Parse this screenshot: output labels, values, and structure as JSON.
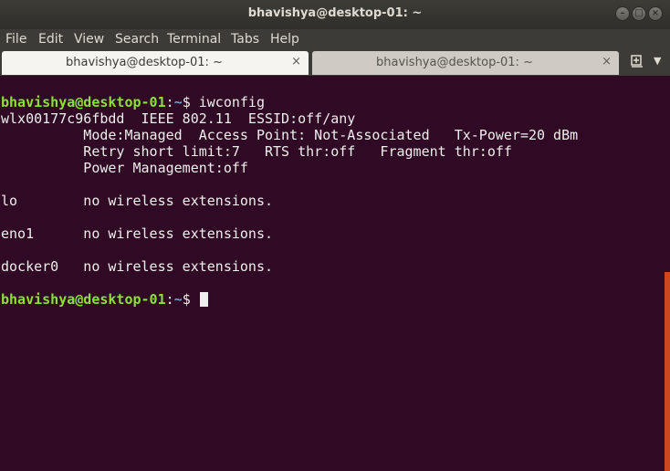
{
  "window": {
    "title": "bhavishya@desktop-01: ~"
  },
  "menu": [
    "File",
    "Edit",
    "View",
    "Search",
    "Terminal",
    "Tabs",
    "Help"
  ],
  "tabs": [
    {
      "label": "bhavishya@desktop-01: ~",
      "close": "×"
    },
    {
      "label": "bhavishya@desktop-01: ~",
      "close": "×"
    }
  ],
  "terminal": {
    "prompt_user": "bhavishya@desktop-01",
    "prompt_path": "~",
    "prompt_suffix": "$ ",
    "command": "iwconfig",
    "output": [
      "wlx00177c96fbdd  IEEE 802.11  ESSID:off/any  ",
      "          Mode:Managed  Access Point: Not-Associated   Tx-Power=20 dBm   ",
      "          Retry short limit:7   RTS thr:off   Fragment thr:off",
      "          Power Management:off",
      "          ",
      "lo        no wireless extensions.",
      "",
      "eno1      no wireless extensions.",
      "",
      "docker0   no wireless extensions.",
      ""
    ]
  },
  "icons": {
    "minimize": "minimize-icon",
    "maximize": "maximize-icon",
    "close": "close-icon",
    "new_tab": "new-tab-icon",
    "menu_arrow": "chevron-down-icon"
  },
  "colors": {
    "terminal_bg": "#300a24",
    "prompt_user": "#8ae234",
    "prompt_path": "#729fcf",
    "scroll_thumb": "#e95420"
  }
}
